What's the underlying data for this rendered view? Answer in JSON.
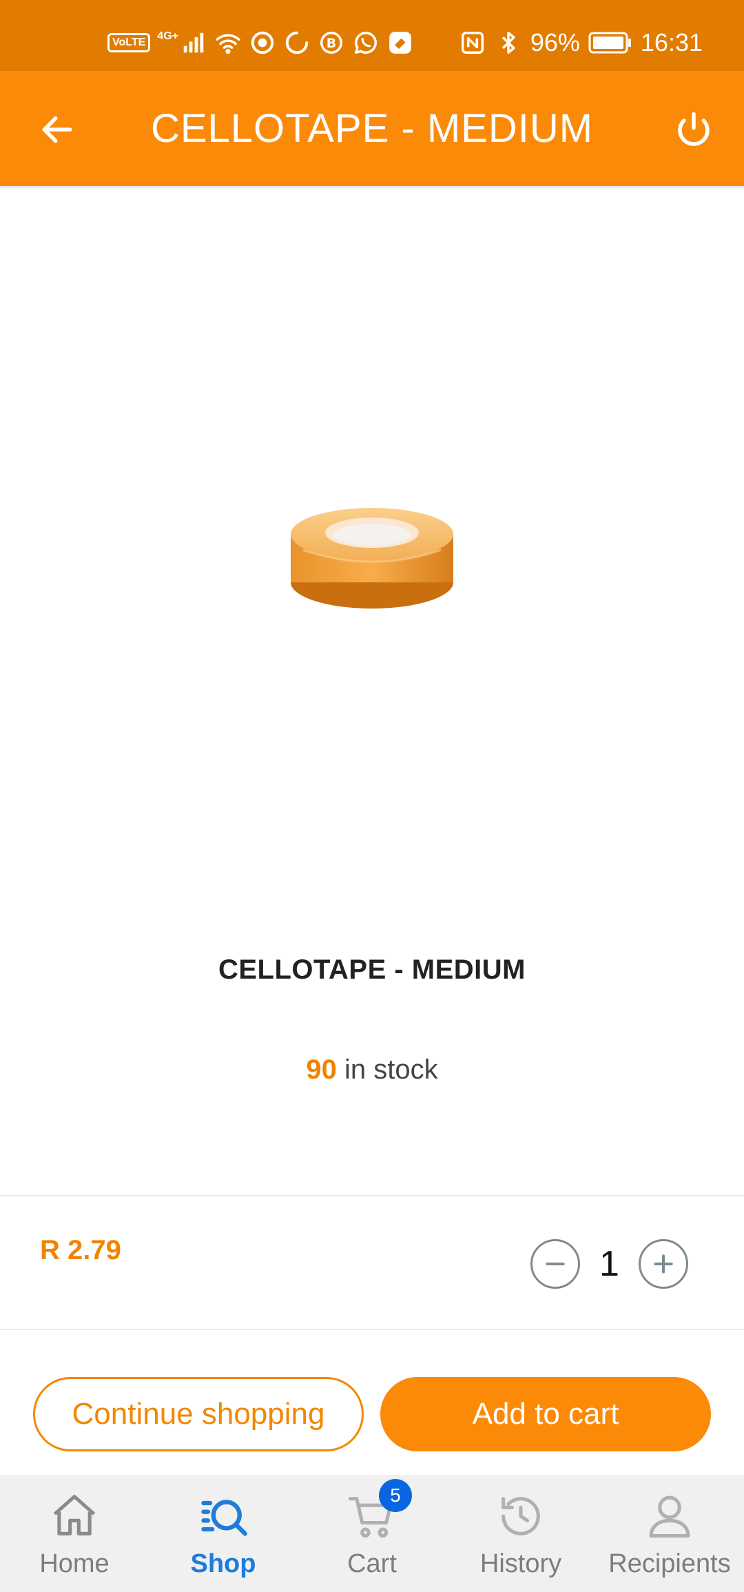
{
  "status_bar": {
    "network_chip": "VoLTE",
    "signal_label": "4G+",
    "battery_percent": "96%",
    "time": "16:31",
    "icons": [
      "volte-icon",
      "signal-icon",
      "wifi-icon",
      "media-icon",
      "loading-icon",
      "b-icon",
      "whatsapp-icon",
      "app-icon",
      "nfc-icon",
      "bluetooth-icon",
      "battery-icon"
    ]
  },
  "app_bar": {
    "title": "CELLOTAPE - MEDIUM",
    "back_icon": "arrow-left-icon",
    "power_icon": "power-icon"
  },
  "product": {
    "image": "cellotape-roll-image",
    "name": "CELLOTAPE - MEDIUM",
    "stock_count": "90",
    "stock_label": " in stock",
    "price": "R 2.79",
    "quantity": "1"
  },
  "actions": {
    "continue_label": "Continue shopping",
    "add_to_cart_label": "Add to cart"
  },
  "bottom_nav": {
    "items": [
      {
        "label": "Home",
        "icon": "home-icon",
        "active": false
      },
      {
        "label": "Shop",
        "icon": "shop-search-icon",
        "active": true
      },
      {
        "label": "Cart",
        "icon": "cart-icon",
        "active": false,
        "badge": "5"
      },
      {
        "label": "History",
        "icon": "history-icon",
        "active": false
      },
      {
        "label": "Recipients",
        "icon": "person-icon",
        "active": false
      }
    ]
  },
  "colors": {
    "status_bar": "#e27c00",
    "app_bar": "#fb8a09",
    "accent": "#f08400",
    "nav_active": "#1e7cdb",
    "badge": "#0a66e0"
  }
}
